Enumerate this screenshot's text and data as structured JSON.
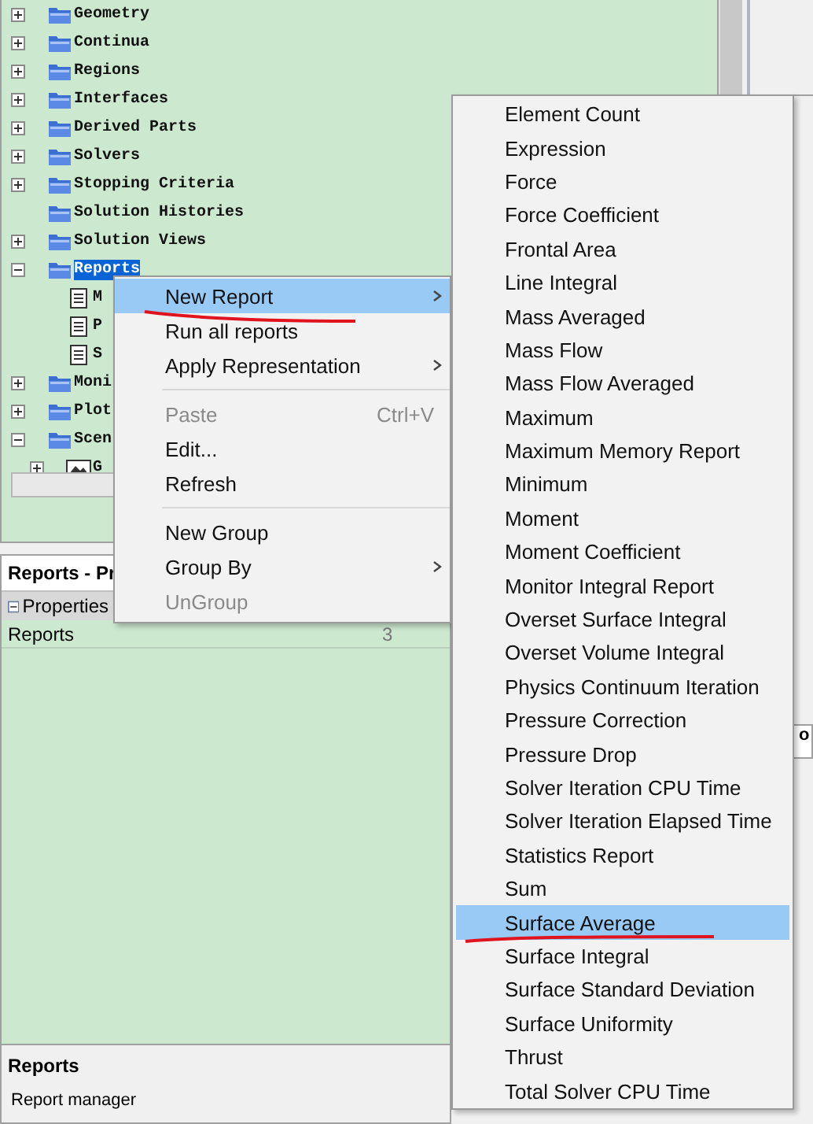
{
  "tree": [
    {
      "label": "Geometry",
      "kind": "folder",
      "expanded": false,
      "selected": false
    },
    {
      "label": "Continua",
      "kind": "folder",
      "expanded": false,
      "selected": false
    },
    {
      "label": "Regions",
      "kind": "folder",
      "expanded": false,
      "selected": false
    },
    {
      "label": "Interfaces",
      "kind": "folder",
      "expanded": false,
      "selected": false
    },
    {
      "label": "Derived Parts",
      "kind": "folder",
      "expanded": false,
      "selected": false
    },
    {
      "label": "Solvers",
      "kind": "folder",
      "expanded": false,
      "selected": false
    },
    {
      "label": "Stopping Criteria",
      "kind": "folder",
      "expanded": false,
      "selected": false
    },
    {
      "label": "Solution Histories",
      "kind": "folder",
      "selected": false
    },
    {
      "label": "Solution Views",
      "kind": "folder",
      "expanded": false,
      "selected": false
    },
    {
      "label": "Reports",
      "kind": "folder",
      "expanded": true,
      "selected": true,
      "children": [
        {
          "label": "M",
          "kind": "report",
          "selected": false
        },
        {
          "label": "P",
          "kind": "report",
          "selected": false
        },
        {
          "label": "S",
          "kind": "report",
          "selected": false
        }
      ]
    },
    {
      "label": "Moni",
      "kind": "folder",
      "expanded": false,
      "selected": false
    },
    {
      "label": "Plot",
      "kind": "folder",
      "expanded": false,
      "selected": false
    },
    {
      "label": "Scen",
      "kind": "folder",
      "expanded": true,
      "selected": false,
      "children": [
        {
          "label": "G",
          "kind": "scene",
          "expanded": false,
          "selected": false
        }
      ]
    }
  ],
  "right_panel": {
    "title": "o"
  },
  "properties_panel": {
    "title": "Reports - Pr",
    "section": "Properties",
    "rows": [
      {
        "name": "Reports",
        "value": "3"
      }
    ],
    "description_title": "Reports",
    "description": "Report manager"
  },
  "context_menu": [
    {
      "kind": "item",
      "label": "New Report",
      "submenu": true,
      "selected": true,
      "disabled": false
    },
    {
      "kind": "item",
      "label": "Run all reports",
      "submenu": false,
      "selected": false,
      "disabled": false
    },
    {
      "kind": "item",
      "label": "Apply Representation",
      "submenu": true,
      "selected": false,
      "disabled": false
    },
    {
      "kind": "separator"
    },
    {
      "kind": "item",
      "label": "Paste",
      "shortcut": "Ctrl+V",
      "submenu": false,
      "selected": false,
      "disabled": true
    },
    {
      "kind": "item",
      "label": "Edit...",
      "submenu": false,
      "selected": false,
      "disabled": false
    },
    {
      "kind": "item",
      "label": "Refresh",
      "submenu": false,
      "selected": false,
      "disabled": false
    },
    {
      "kind": "separator"
    },
    {
      "kind": "item",
      "label": "New Group",
      "submenu": false,
      "selected": false,
      "disabled": false
    },
    {
      "kind": "item",
      "label": "Group By",
      "submenu": true,
      "selected": false,
      "disabled": false
    },
    {
      "kind": "item",
      "label": "UnGroup",
      "submenu": false,
      "selected": false,
      "disabled": true
    }
  ],
  "submenu": [
    {
      "label": "Element Count",
      "selected": false
    },
    {
      "label": "Expression",
      "selected": false
    },
    {
      "label": "Force",
      "selected": false
    },
    {
      "label": "Force Coefficient",
      "selected": false
    },
    {
      "label": "Frontal Area",
      "selected": false
    },
    {
      "label": "Line Integral",
      "selected": false
    },
    {
      "label": "Mass Averaged",
      "selected": false
    },
    {
      "label": "Mass Flow",
      "selected": false
    },
    {
      "label": "Mass Flow Averaged",
      "selected": false
    },
    {
      "label": "Maximum",
      "selected": false
    },
    {
      "label": "Maximum Memory Report",
      "selected": false
    },
    {
      "label": "Minimum",
      "selected": false
    },
    {
      "label": "Moment",
      "selected": false
    },
    {
      "label": "Moment Coefficient",
      "selected": false
    },
    {
      "label": "Monitor Integral Report",
      "selected": false
    },
    {
      "label": "Overset Surface Integral",
      "selected": false
    },
    {
      "label": "Overset Volume Integral",
      "selected": false
    },
    {
      "label": "Physics Continuum Iteration",
      "selected": false
    },
    {
      "label": "Pressure Correction",
      "selected": false
    },
    {
      "label": "Pressure Drop",
      "selected": false
    },
    {
      "label": "Solver Iteration CPU Time",
      "selected": false
    },
    {
      "label": "Solver Iteration Elapsed Time",
      "selected": false
    },
    {
      "label": "Statistics Report",
      "selected": false
    },
    {
      "label": "Sum",
      "selected": false
    },
    {
      "label": "Surface Average",
      "selected": true
    },
    {
      "label": "Surface Integral",
      "selected": false
    },
    {
      "label": "Surface Standard Deviation",
      "selected": false
    },
    {
      "label": "Surface Uniformity",
      "selected": false
    },
    {
      "label": "Thrust",
      "selected": false
    },
    {
      "label": "Total Solver CPU Time",
      "selected": false
    }
  ]
}
